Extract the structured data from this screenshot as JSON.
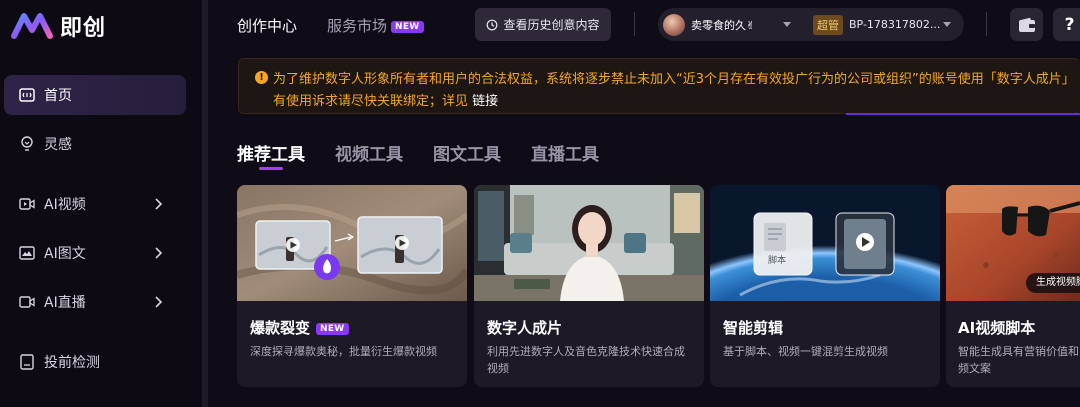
{
  "app": {
    "logo_text": "即创"
  },
  "sidebar": {
    "items": [
      {
        "label": "首页",
        "icon": "home-icon",
        "active": true
      },
      {
        "label": "灵感",
        "icon": "lightbulb-icon"
      },
      {
        "label": "AI视频",
        "icon": "video-icon",
        "chevron": true
      },
      {
        "label": "AI图文",
        "icon": "image-icon",
        "chevron": true
      },
      {
        "label": "AI直播",
        "icon": "live-icon",
        "chevron": true
      },
      {
        "label": "投前检测",
        "icon": "document-check-icon"
      }
    ]
  },
  "header": {
    "tabs": [
      {
        "label": "创作中心",
        "active": true
      },
      {
        "label": "服务市场",
        "badge": "NEW"
      }
    ],
    "history_button": "查看历史创意内容",
    "account": {
      "name": "卖零食的久✌",
      "vip_badge": "超管",
      "bp_id": "BP-178317802..."
    },
    "help_label": "?"
  },
  "notice": {
    "line1": "为了维护数字人形象所有者和用户的合法权益，系统将逐步禁止未加入“近3个月存在有效投广行为的公司或组织”的账号使用「数字人成片」",
    "line2": "有使用诉求请尽快关联绑定；详见",
    "link": "链接"
  },
  "tool_tabs": [
    {
      "label": "推荐工具",
      "active": true
    },
    {
      "label": "视频工具"
    },
    {
      "label": "图文工具"
    },
    {
      "label": "直播工具"
    }
  ],
  "cards": [
    {
      "title": "爆款裂变",
      "badge": "NEW",
      "desc": "深度探寻爆款奥秘，批量衍生爆款视频"
    },
    {
      "title": "数字人成片",
      "desc": "利用先进数字人及音色克隆技术快速合成视频"
    },
    {
      "title": "智能剪辑",
      "desc": "基于脚本、视频一键混剪生成视频",
      "thumb_label": "脚本"
    },
    {
      "title": "AI视频脚本",
      "desc": "智能生成具有营销价值和频文案",
      "thumb_tag": "生成视频脚"
    }
  ],
  "colors": {
    "accent": "#9b44f7",
    "new_badge": "#8a38f5",
    "notice_text": "#f5a623",
    "background": "#0f0b17"
  }
}
